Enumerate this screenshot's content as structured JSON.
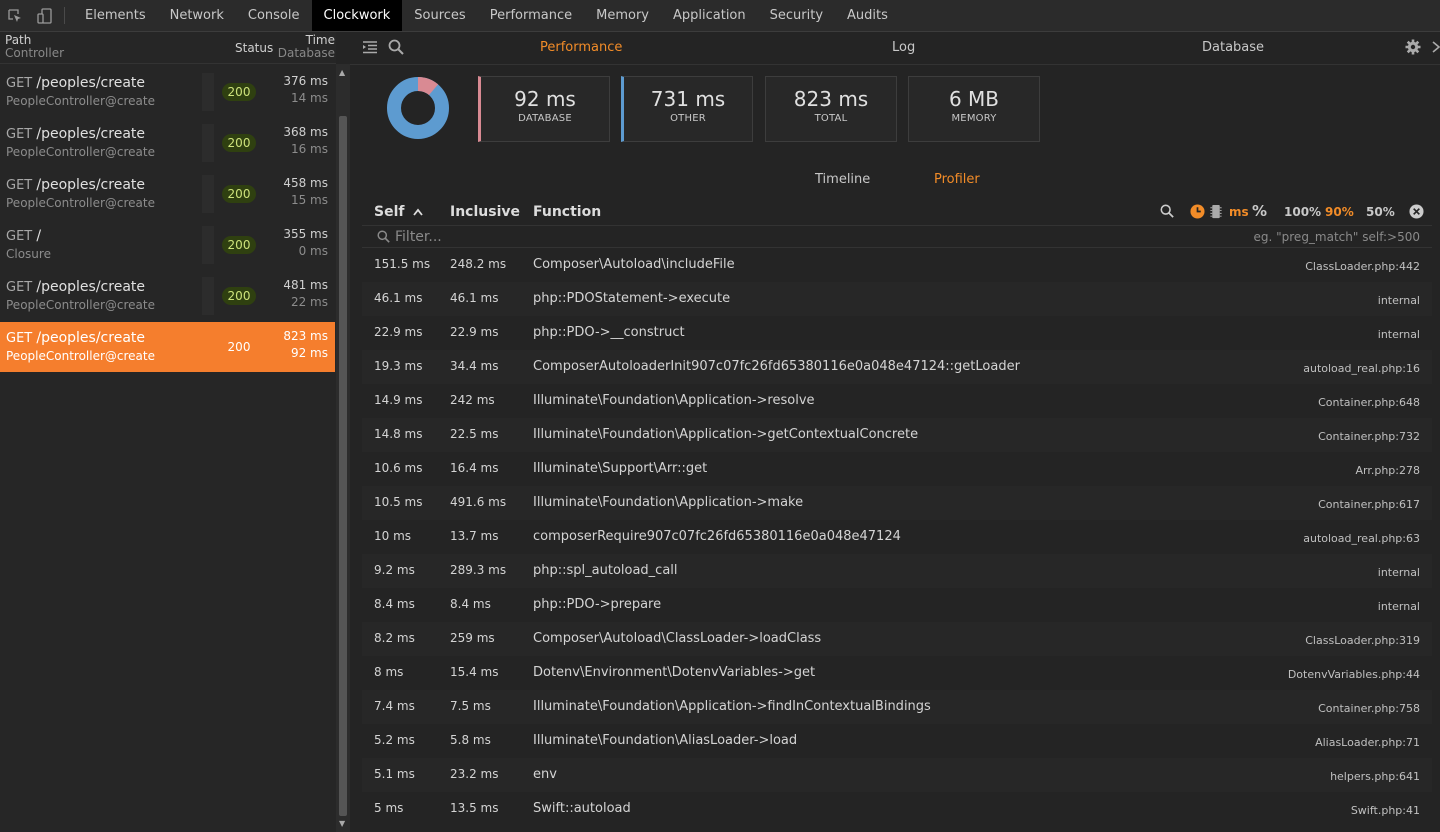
{
  "devtools": {
    "tabs": [
      "Elements",
      "Network",
      "Console",
      "Clockwork",
      "Sources",
      "Performance",
      "Memory",
      "Application",
      "Security",
      "Audits"
    ],
    "active_tab": "Clockwork"
  },
  "sidebar": {
    "header": {
      "path": "Path",
      "controller": "Controller",
      "status": "Status",
      "time": "Time",
      "database": "Database"
    },
    "requests": [
      {
        "method": "GET",
        "path": "/peoples/create",
        "controller": "PeopleController@create",
        "status": "200",
        "time": "376 ms",
        "db": "14 ms"
      },
      {
        "method": "GET",
        "path": "/peoples/create",
        "controller": "PeopleController@create",
        "status": "200",
        "time": "368 ms",
        "db": "16 ms"
      },
      {
        "method": "GET",
        "path": "/peoples/create",
        "controller": "PeopleController@create",
        "status": "200",
        "time": "458 ms",
        "db": "15 ms"
      },
      {
        "method": "GET",
        "path": "/",
        "controller": "Closure",
        "status": "200",
        "time": "355 ms",
        "db": "0 ms"
      },
      {
        "method": "GET",
        "path": "/peoples/create",
        "controller": "PeopleController@create",
        "status": "200",
        "time": "481 ms",
        "db": "22 ms"
      },
      {
        "method": "GET",
        "path": "/peoples/create",
        "controller": "PeopleController@create",
        "status": "200",
        "time": "823 ms",
        "db": "92 ms"
      }
    ],
    "selected_index": 5
  },
  "main": {
    "tabs": [
      "Performance",
      "Log",
      "Database"
    ],
    "active_tab": "Performance",
    "summary": {
      "database": {
        "value": "92 ms",
        "label": "DATABASE"
      },
      "other": {
        "value": "731 ms",
        "label": "OTHER"
      },
      "total": {
        "value": "823 ms",
        "label": "TOTAL"
      },
      "memory": {
        "value": "6 MB",
        "label": "MEMORY"
      },
      "donut": {
        "database_fraction": 0.112,
        "database_color": "#d98a93",
        "other_color": "#5d9bd0"
      }
    },
    "subtabs": [
      "Timeline",
      "Profiler"
    ],
    "active_subtab": "Profiler"
  },
  "profiler": {
    "columns": {
      "self": "Self",
      "inclusive": "Inclusive",
      "function": "Function"
    },
    "controls": {
      "ms": "ms",
      "percent": "%",
      "p100": "100%",
      "p90": "90%",
      "p50": "50%"
    },
    "filter": {
      "placeholder": "Filter...",
      "hint": "eg. \"preg_match\" self:>500"
    },
    "rows": [
      {
        "self": "151.5 ms",
        "inclusive": "248.2 ms",
        "function": "Composer\\Autoload\\includeFile",
        "file": "ClassLoader.php:442"
      },
      {
        "self": "46.1 ms",
        "inclusive": "46.1 ms",
        "function": "php::PDOStatement->execute",
        "file": "internal"
      },
      {
        "self": "22.9 ms",
        "inclusive": "22.9 ms",
        "function": "php::PDO->__construct",
        "file": "internal"
      },
      {
        "self": "19.3 ms",
        "inclusive": "34.4 ms",
        "function": "ComposerAutoloaderInit907c07fc26fd65380116e0a048e47124::getLoader",
        "file": "autoload_real.php:16"
      },
      {
        "self": "14.9 ms",
        "inclusive": "242 ms",
        "function": "Illuminate\\Foundation\\Application->resolve",
        "file": "Container.php:648"
      },
      {
        "self": "14.8 ms",
        "inclusive": "22.5 ms",
        "function": "Illuminate\\Foundation\\Application->getContextualConcrete",
        "file": "Container.php:732"
      },
      {
        "self": "10.6 ms",
        "inclusive": "16.4 ms",
        "function": "Illuminate\\Support\\Arr::get",
        "file": "Arr.php:278"
      },
      {
        "self": "10.5 ms",
        "inclusive": "491.6 ms",
        "function": "Illuminate\\Foundation\\Application->make",
        "file": "Container.php:617"
      },
      {
        "self": "10 ms",
        "inclusive": "13.7 ms",
        "function": "composerRequire907c07fc26fd65380116e0a048e47124",
        "file": "autoload_real.php:63"
      },
      {
        "self": "9.2 ms",
        "inclusive": "289.3 ms",
        "function": "php::spl_autoload_call",
        "file": "internal"
      },
      {
        "self": "8.4 ms",
        "inclusive": "8.4 ms",
        "function": "php::PDO->prepare",
        "file": "internal"
      },
      {
        "self": "8.2 ms",
        "inclusive": "259 ms",
        "function": "Composer\\Autoload\\ClassLoader->loadClass",
        "file": "ClassLoader.php:319"
      },
      {
        "self": "8 ms",
        "inclusive": "15.4 ms",
        "function": "Dotenv\\Environment\\DotenvVariables->get",
        "file": "DotenvVariables.php:44"
      },
      {
        "self": "7.4 ms",
        "inclusive": "7.5 ms",
        "function": "Illuminate\\Foundation\\Application->findInContextualBindings",
        "file": "Container.php:758"
      },
      {
        "self": "5.2 ms",
        "inclusive": "5.8 ms",
        "function": "Illuminate\\Foundation\\AliasLoader->load",
        "file": "AliasLoader.php:71"
      },
      {
        "self": "5.1 ms",
        "inclusive": "23.2 ms",
        "function": "env",
        "file": "helpers.php:641"
      },
      {
        "self": "5 ms",
        "inclusive": "13.5 ms",
        "function": "Swift::autoload",
        "file": "Swift.php:41"
      }
    ]
  },
  "icons": [
    "inspect-element-icon",
    "device-toggle-icon",
    "menu-icon",
    "search-icon",
    "gear-icon",
    "dock-icon",
    "sort-ascending-icon",
    "clock-icon",
    "memory-icon",
    "close-circle-icon"
  ]
}
